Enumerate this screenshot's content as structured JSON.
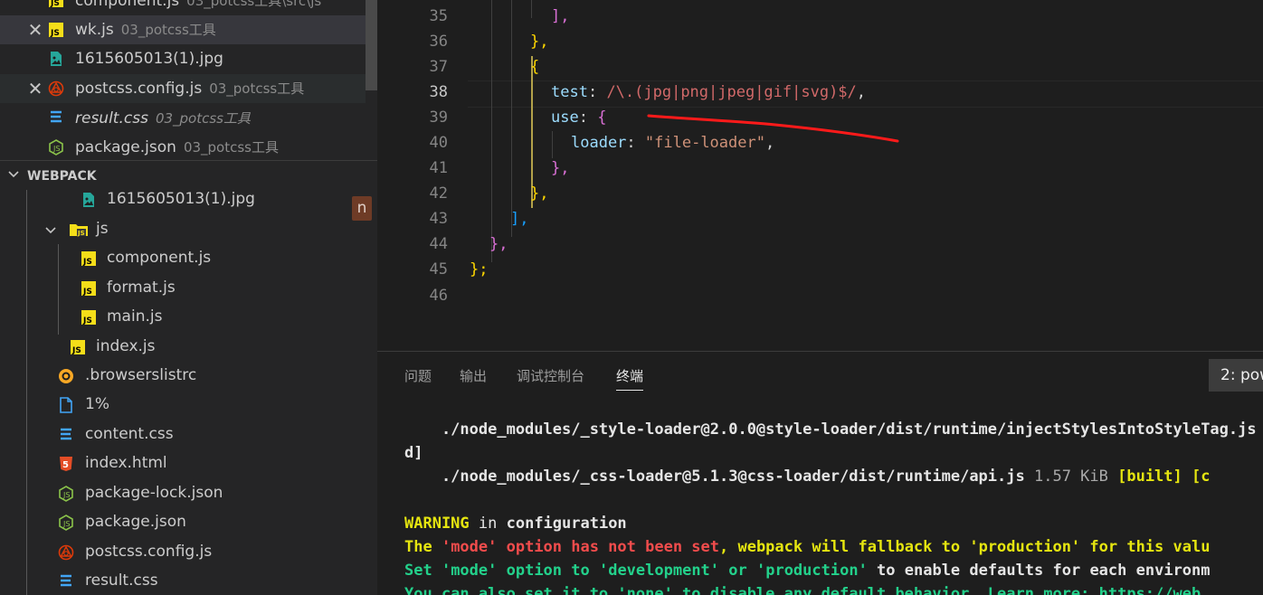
{
  "open_editors": [
    {
      "name": "component.js",
      "desc": "03_potcss工具\\src\\js",
      "icon": "js-file-icon",
      "italic": false
    },
    {
      "name": "wk.js",
      "desc": "03_potcss工具",
      "icon": "js-file-icon",
      "italic": false,
      "close": "✕"
    },
    {
      "name": "1615605013(1).jpg",
      "desc": "",
      "icon": "image-file-icon",
      "italic": false
    },
    {
      "name": "postcss.config.js",
      "desc": "03_potcss工具",
      "icon": "postcss-file-icon",
      "italic": false,
      "close": "✕"
    },
    {
      "name": "result.css",
      "desc": "03_potcss工具",
      "icon": "css-file-icon",
      "italic": true
    },
    {
      "name": "package.json",
      "desc": "03_potcss工具",
      "icon": "node-json-file-icon",
      "italic": false
    }
  ],
  "explorer": {
    "section_title": "WEBPACK",
    "badge": "n",
    "items": [
      {
        "label": "1615605013(1).jpg",
        "icon": "image-file-icon"
      },
      {
        "label": "js",
        "icon": "js-folder-icon"
      },
      {
        "label": "component.js",
        "icon": "js-file-icon"
      },
      {
        "label": "format.js",
        "icon": "js-file-icon"
      },
      {
        "label": "main.js",
        "icon": "js-file-icon"
      },
      {
        "label": "index.js",
        "icon": "js-file-icon"
      },
      {
        "label": ".browserslistrc",
        "icon": "browserslist-file-icon"
      },
      {
        "label": "1%",
        "icon": "generic-file-icon"
      },
      {
        "label": "content.css",
        "icon": "css-file-icon"
      },
      {
        "label": "index.html",
        "icon": "html-file-icon"
      },
      {
        "label": "package-lock.json",
        "icon": "node-json-file-icon"
      },
      {
        "label": "package.json",
        "icon": "node-json-file-icon"
      },
      {
        "label": "postcss.config.js",
        "icon": "postcss-file-icon"
      },
      {
        "label": "result.css",
        "icon": "css-file-icon"
      }
    ]
  },
  "editor": {
    "line_numbers": [
      "35",
      "36",
      "37",
      "38",
      "39",
      "40",
      "41",
      "42",
      "43",
      "44",
      "45",
      "46"
    ],
    "current_line": "38",
    "lines": {
      "l35": "],",
      "l36": "},",
      "l37": "{",
      "l38_key": "test",
      "l38_regex": "/\\.(jpg|png|jpeg|gif|svg)$/",
      "l39_key": "use",
      "l40_key": "loader",
      "l40_value": "\"file-loader\"",
      "l41": "},",
      "l42": "},",
      "l43": "],",
      "l44": "},",
      "l45": "};"
    }
  },
  "panel": {
    "tabs": [
      "问题",
      "输出",
      "调试控制台",
      "终端"
    ],
    "active_tab": "终端",
    "terminal_select": "2: pow",
    "terminal": {
      "l1": "    ./node_modules/_style-loader@2.0.0@style-loader/dist/runtime/injectStylesIntoStyleTag.js",
      "l2": "d]",
      "l3_path": "    ./node_modules/_css-loader@5.1.3@css-loader/dist/runtime/api.js",
      "l3_size": " 1.57 KiB",
      "l3_built": " [built]",
      "l3_tail": " [c",
      "warn_word": "WARNING",
      "warn_in": " in ",
      "warn_cfg": "configuration",
      "l6_a": "The ",
      "l6_b": "'mode' option has not been set",
      "l6_c": ", webpack will fallback to 'production' for this valu",
      "l7_a": "Set ",
      "l7_b": "'mode'",
      "l7_c": " option to ",
      "l7_d": "'development'",
      "l7_e": " or ",
      "l7_f": "'production'",
      "l7_g": " to enable defaults for each environm",
      "l8": "You can also set it to 'none' to disable any default behavior. Learn more: https://web"
    }
  },
  "colors": {
    "annotation_stroke": "#ff1a1a",
    "sidebar_bg": "#252526",
    "editor_bg": "#1e1e1e"
  }
}
